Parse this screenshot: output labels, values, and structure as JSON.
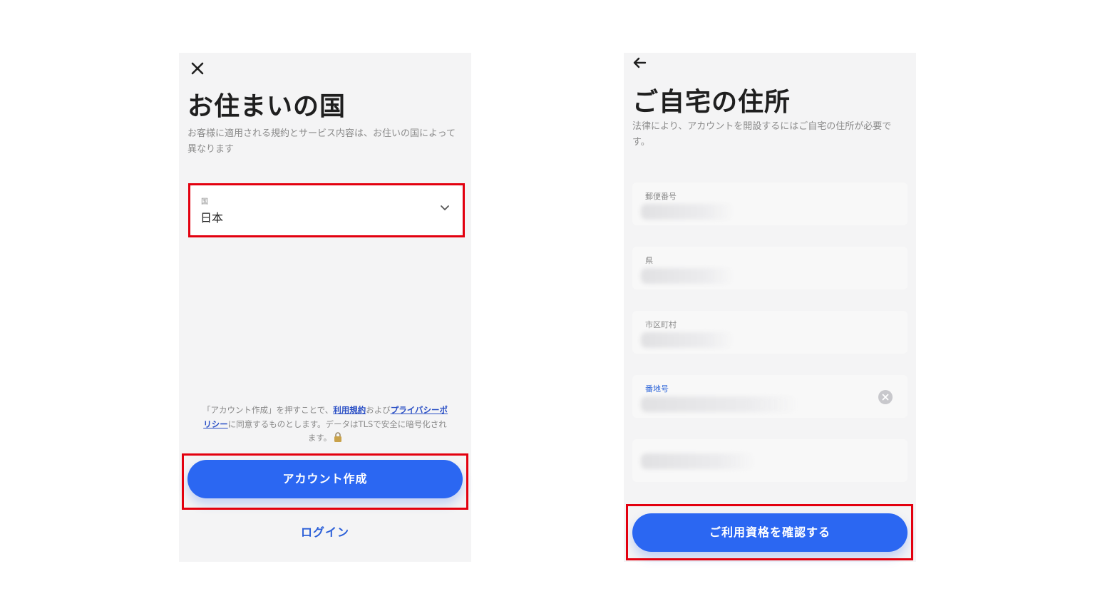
{
  "left_screen": {
    "close_icon": "close-icon",
    "title": "お住まいの国",
    "subtitle": "お客様に適用される規約とサービス内容は、お住いの国によって異なります",
    "country_field": {
      "label": "国",
      "value": "日本",
      "icon": "chevron-down-icon"
    },
    "terms": {
      "part1": "「アカウント作成」を押すことで、",
      "terms_link": "利用規約",
      "part2": "および",
      "privacy_link": "プライバシーポリシー",
      "part3": "に同意するものとします。データはTLSで安全に暗号化されます。",
      "icon": "lock-icon"
    },
    "create_button": "アカウント作成",
    "login_link": "ログイン"
  },
  "right_screen": {
    "back_icon": "arrow-left-icon",
    "title": "ご自宅の住所",
    "subtitle": "法律により、アカウントを開設するにはご自宅の住所が必要です。",
    "fields": [
      {
        "label": "郵便番号"
      },
      {
        "label": "県"
      },
      {
        "label": "市区町村"
      },
      {
        "label": "番地号",
        "icon": "clear-icon"
      },
      {
        "label": ""
      }
    ],
    "confirm_button": "ご利用資格を確認する"
  },
  "colors": {
    "primary": "#2b67f2",
    "highlight": "#e3000f",
    "link": "#2a4fc5"
  }
}
